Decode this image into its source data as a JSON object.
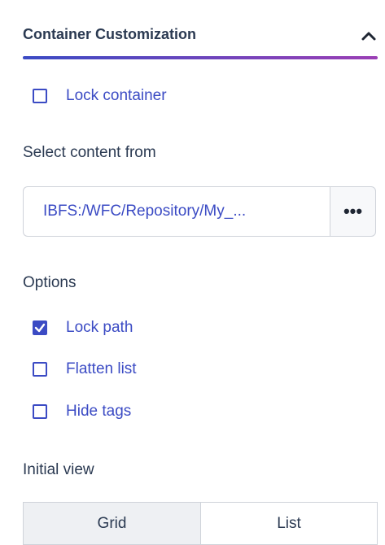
{
  "header": {
    "title": "Container Customization",
    "collapse_icon": "chevron-up-icon",
    "rule_colors": [
      "#3b4bc4",
      "#9b3fb5"
    ]
  },
  "lock_container": {
    "label": "Lock container",
    "checked": false
  },
  "select_content": {
    "label": "Select content from",
    "path_value": "IBFS:/WFC/Repository/My_...",
    "browse_label": "•••"
  },
  "options": {
    "label": "Options",
    "items": [
      {
        "label": "Lock path",
        "checked": true
      },
      {
        "label": "Flatten list",
        "checked": false
      },
      {
        "label": "Hide tags",
        "checked": false
      }
    ]
  },
  "initial_view": {
    "label": "Initial view",
    "buttons": [
      {
        "label": "Grid",
        "selected": true
      },
      {
        "label": "List",
        "selected": false
      }
    ]
  },
  "colors": {
    "accent": "#3b4bc4",
    "text": "#2b3a52"
  }
}
